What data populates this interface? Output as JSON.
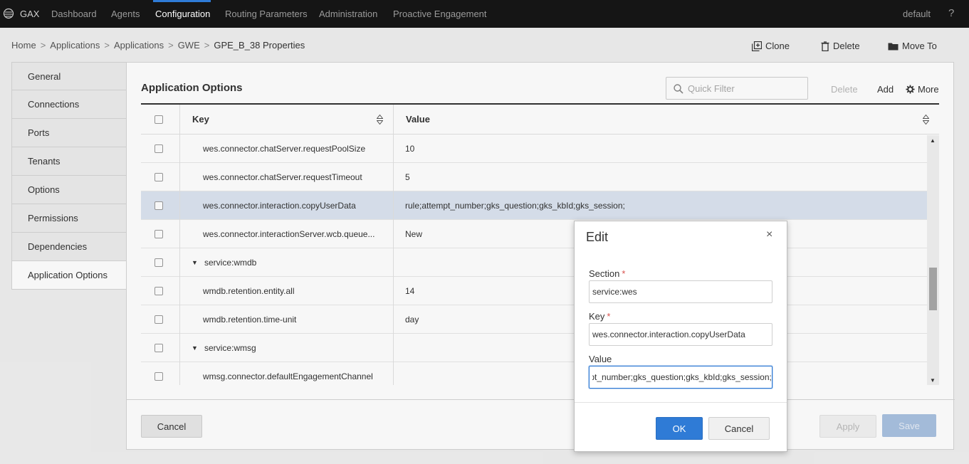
{
  "nav": {
    "brand": "GAX",
    "items": [
      "Dashboard",
      "Agents",
      "Configuration",
      "Routing Parameters",
      "Administration",
      "Proactive Engagement"
    ],
    "active": "Configuration",
    "user": "default",
    "help": "?"
  },
  "breadcrumb": [
    "Home",
    "Applications",
    "Applications",
    "GWE",
    "GPE_B_38 Properties"
  ],
  "breadcrumb_sep": ">",
  "actions": {
    "clone": "Clone",
    "delete": "Delete",
    "move_to": "Move To"
  },
  "sidebar": {
    "items": [
      "General",
      "Connections",
      "Ports",
      "Tenants",
      "Options",
      "Permissions",
      "Dependencies",
      "Application Options"
    ],
    "active": "Application Options"
  },
  "panel": {
    "title": "Application Options",
    "filter_placeholder": "Quick Filter",
    "delete": "Delete",
    "add": "Add",
    "more": "More"
  },
  "table": {
    "columns": [
      "Key",
      "Value"
    ],
    "rows": [
      {
        "key": "wes.connector.chatServer.requestPoolSize",
        "value": "10",
        "type": "option"
      },
      {
        "key": "wes.connector.chatServer.requestTimeout",
        "value": "5",
        "type": "option"
      },
      {
        "key": "wes.connector.interaction.copyUserData",
        "value": "rule;attempt_number;gks_question;gks_kbId;gks_session;",
        "type": "option",
        "selected": true
      },
      {
        "key": "wes.connector.interactionServer.wcb.queue...",
        "value": "New",
        "type": "option"
      },
      {
        "key": "service:wmdb",
        "value": "",
        "type": "section"
      },
      {
        "key": "wmdb.retention.entity.all",
        "value": "14",
        "type": "option"
      },
      {
        "key": "wmdb.retention.time-unit",
        "value": "day",
        "type": "option"
      },
      {
        "key": "service:wmsg",
        "value": "",
        "type": "section"
      },
      {
        "key": "wmsg.connector.defaultEngagementChannel",
        "value": "",
        "type": "option"
      }
    ]
  },
  "footer": {
    "cancel": "Cancel",
    "apply": "Apply",
    "save": "Save"
  },
  "dialog": {
    "title": "Edit",
    "close": "×",
    "section_label": "Section",
    "section_value": "service:wes",
    "key_label": "Key",
    "key_value": "wes.connector.interaction.copyUserData",
    "value_label": "Value",
    "value_value": "rule;attempt_number;gks_question;gks_kbId;gks_session;",
    "required_mark": "*",
    "ok": "OK",
    "cancel": "Cancel"
  },
  "colors": {
    "topbar": "#151515",
    "accent": "#2f7bd6",
    "selected_row": "#dbe4f0",
    "save_disabled": "#a9c2e0"
  }
}
